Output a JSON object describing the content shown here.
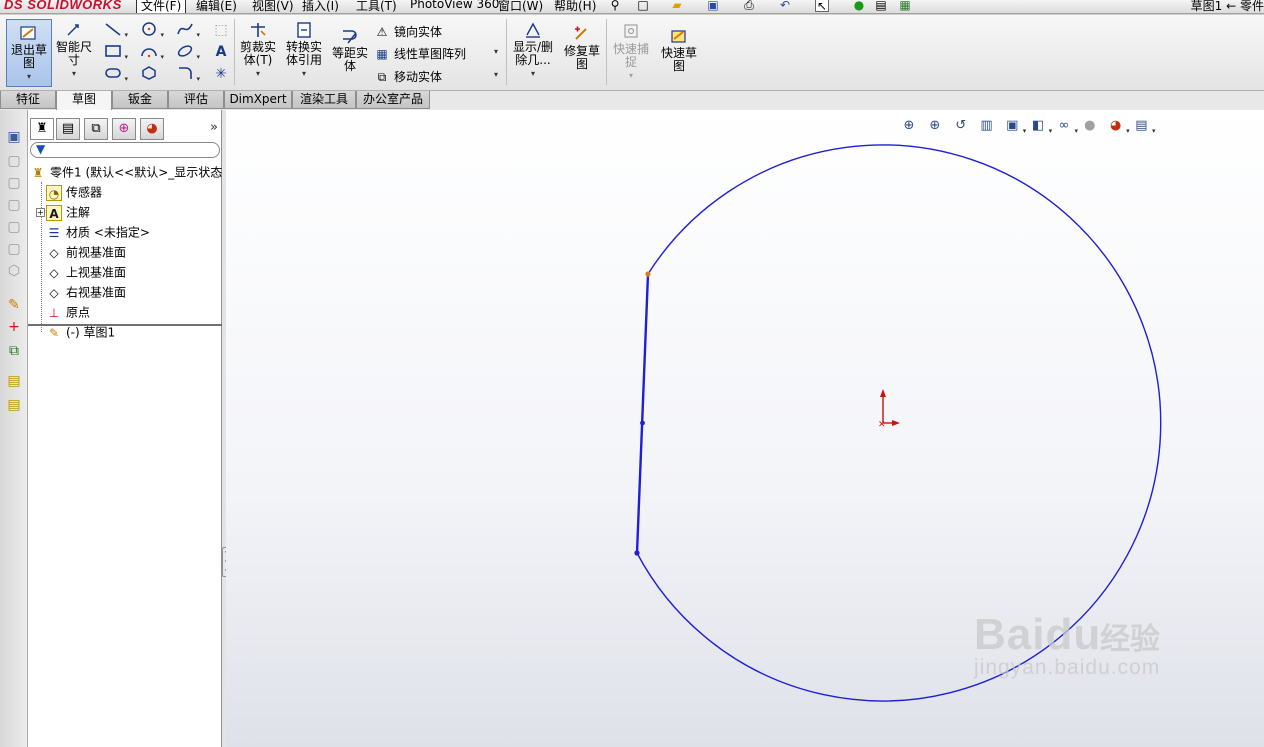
{
  "app": {
    "logo": "SOLIDWORKS",
    "logo_prefix": "DS",
    "doc_title": "草图1 ← 零件"
  },
  "menu": {
    "items": [
      {
        "label": "文件(F)"
      },
      {
        "label": "编辑(E)"
      },
      {
        "label": "视图(V)"
      },
      {
        "label": "插入(I)"
      },
      {
        "label": "工具(T)"
      },
      {
        "label": "PhotoView 360"
      },
      {
        "label": "窗口(W)"
      },
      {
        "label": "帮助(H)"
      }
    ]
  },
  "ribbon": {
    "exit_sketch": "退出草图",
    "smart_dim": "智能尺寸",
    "trim": "剪裁实体(T)",
    "convert": "转换实体引用",
    "offset": "等距实体",
    "mirror": "镜向实体",
    "linear_pattern": "线性草图阵列",
    "move": "移动实体",
    "show_delete": "显示/删除几...",
    "repair": "修复草图",
    "quick_snap": "快速捕捉",
    "rapid_sketch": "快速草图"
  },
  "tabs": [
    {
      "label": "特征"
    },
    {
      "label": "草图"
    },
    {
      "label": "钣金"
    },
    {
      "label": "评估"
    },
    {
      "label": "DimXpert"
    },
    {
      "label": "渲染工具"
    },
    {
      "label": "办公室产品"
    }
  ],
  "tree": {
    "root": "零件1 (默认<<默认>_显示状态",
    "sensors": "传感器",
    "annotations": "注解",
    "material": "材质 <未指定>",
    "front_plane": "前视基准面",
    "top_plane": "上视基准面",
    "right_plane": "右视基准面",
    "origin": "原点",
    "sketch1": "(-) 草图1"
  },
  "sketch": {
    "line_color": "#1f1fd6",
    "endpoint_color": "#e07b1a",
    "origin_color": "#d01010"
  },
  "watermark": {
    "brand": "Baidu",
    "brand_cn": "经验",
    "sub": "jingyan.baidu.com"
  },
  "colors": {
    "active_tab_bg": "#f5f5f5",
    "ribbon_active": "#a9c4ea"
  }
}
